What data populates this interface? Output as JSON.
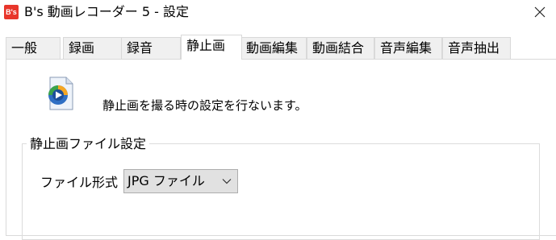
{
  "window": {
    "app_icon_text": "B's",
    "title": "B's 動画レコーダー 5 - 設定",
    "close_glyph": "✕"
  },
  "tabs": [
    {
      "label": "一般",
      "active": false
    },
    {
      "label": "録画",
      "active": false
    },
    {
      "label": "録音",
      "active": false
    },
    {
      "label": "静止画",
      "active": true
    },
    {
      "label": "動画編集",
      "active": false
    },
    {
      "label": "動画結合",
      "active": false
    },
    {
      "label": "音声編集",
      "active": false
    },
    {
      "label": "音声抽出",
      "active": false
    }
  ],
  "panel": {
    "icon": "media-player-icon",
    "description": "静止画を撮る時の設定を行ないます。",
    "group_title": "静止画ファイル設定",
    "format_label": "ファイル形式 :",
    "format_value": "JPG ファイル"
  },
  "colors": {
    "app_icon_bg": "#e8362b",
    "tab_bg": "#f0f0f0",
    "select_bg": "#e1e1e1"
  }
}
